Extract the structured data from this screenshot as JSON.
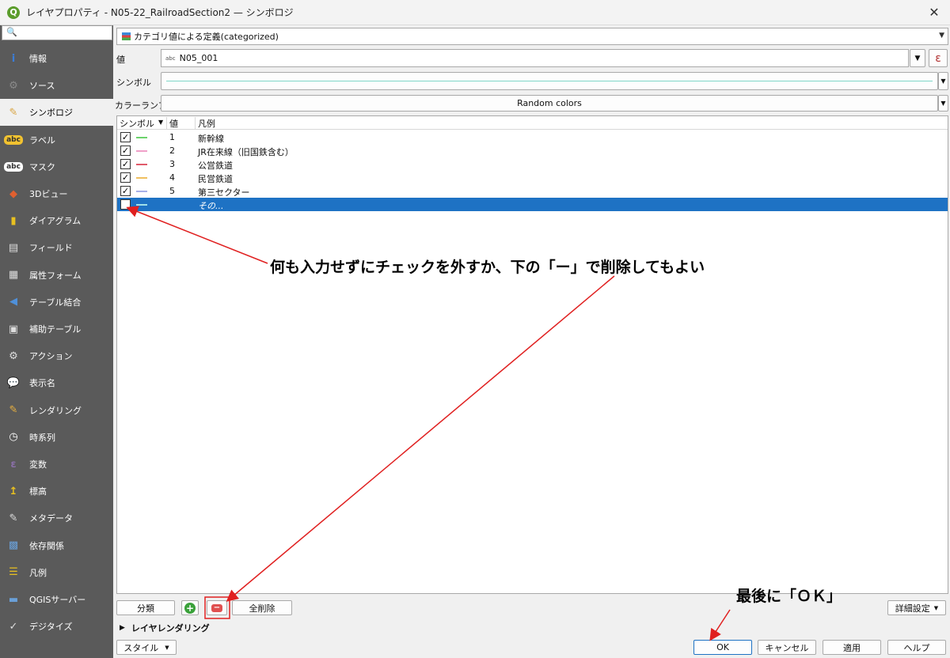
{
  "window": {
    "title": "レイヤプロパティ - N05-22_RailroadSection2 — シンボロジ",
    "app_icon": "Q",
    "close": "✕"
  },
  "sidebar": {
    "search_icon": "🔍",
    "items": [
      {
        "label": "情報",
        "icon": "info-icon",
        "glyph": "i",
        "color": "#3b7dd8"
      },
      {
        "label": "ソース",
        "icon": "source-icon",
        "glyph": "⚙",
        "color": "#8a8a8a"
      },
      {
        "label": "シンボロジ",
        "icon": "paintbrush-icon",
        "glyph": "✎",
        "color": "#d9a441"
      },
      {
        "label": "ラベル",
        "icon": "label-icon",
        "glyph": "abc",
        "color": "#f2c230"
      },
      {
        "label": "マスク",
        "icon": "mask-icon",
        "glyph": "abc",
        "color": "#ffffff"
      },
      {
        "label": "3Dビュー",
        "icon": "cube-icon",
        "glyph": "◆",
        "color": "#e06030"
      },
      {
        "label": "ダイアグラム",
        "icon": "diagram-icon",
        "glyph": "▮",
        "color": "#e8c020"
      },
      {
        "label": "フィールド",
        "icon": "fields-icon",
        "glyph": "▤",
        "color": "#dddddd"
      },
      {
        "label": "属性フォーム",
        "icon": "form-icon",
        "glyph": "▦",
        "color": "#dddddd"
      },
      {
        "label": "テーブル結合",
        "icon": "join-icon",
        "glyph": "◀",
        "color": "#4f90d9"
      },
      {
        "label": "補助テーブル",
        "icon": "auxiliary-icon",
        "glyph": "▣",
        "color": "#dddddd"
      },
      {
        "label": "アクション",
        "icon": "action-icon",
        "glyph": "⚙",
        "color": "#dddddd"
      },
      {
        "label": "表示名",
        "icon": "tooltip-icon",
        "glyph": "💬",
        "color": "#f5c842"
      },
      {
        "label": "レンダリング",
        "icon": "rendering-icon",
        "glyph": "✎",
        "color": "#e8b040"
      },
      {
        "label": "時系列",
        "icon": "clock-icon",
        "glyph": "◷",
        "color": "#ffffff"
      },
      {
        "label": "変数",
        "icon": "variable-icon",
        "glyph": "ε",
        "color": "#8a6fa8"
      },
      {
        "label": "標高",
        "icon": "elevation-icon",
        "glyph": "↥",
        "color": "#e8c020"
      },
      {
        "label": "メタデータ",
        "icon": "metadata-icon",
        "glyph": "✎",
        "color": "#dddddd"
      },
      {
        "label": "依存関係",
        "icon": "dependency-icon",
        "glyph": "▩",
        "color": "#6aa0d8"
      },
      {
        "label": "凡例",
        "icon": "legend-icon",
        "glyph": "☰",
        "color": "#e8c020"
      },
      {
        "label": "QGISサーバー",
        "icon": "server-icon",
        "glyph": "▬",
        "color": "#6aa0d8"
      },
      {
        "label": "デジタイズ",
        "icon": "digitize-icon",
        "glyph": "✓",
        "color": "#dddddd"
      }
    ]
  },
  "renderer": {
    "selected": "カテゴリ値による定義(categorized)"
  },
  "value_field": {
    "label": "値",
    "type_badge": "abc",
    "value": "N05_001",
    "expr_icon": "ε"
  },
  "symbol": {
    "label": "シンボル",
    "line_color": "#7fd6c9"
  },
  "color_ramp": {
    "label": "カラーランプ",
    "value": "Random colors"
  },
  "table": {
    "headers": {
      "symbol": "シンボル",
      "value": "値",
      "legend": "凡例"
    },
    "rows": [
      {
        "checked": true,
        "color": "#6cd36c",
        "value": "1",
        "legend": "新幹線"
      },
      {
        "checked": true,
        "color": "#f0a0c8",
        "value": "2",
        "legend": "JR在来線（旧国鉄含む）"
      },
      {
        "checked": true,
        "color": "#e05a6a",
        "value": "3",
        "legend": "公営鉄道"
      },
      {
        "checked": true,
        "color": "#f0c060",
        "value": "4",
        "legend": "民営鉄道"
      },
      {
        "checked": true,
        "color": "#a8b0e8",
        "value": "5",
        "legend": "第三セクター"
      },
      {
        "checked": false,
        "color": "#9fe0e8",
        "value": "",
        "legend": "その..."
      }
    ]
  },
  "buttons": {
    "classify": "分類",
    "add": "+",
    "remove": "−",
    "delete_all": "全削除",
    "advanced": "詳細設定",
    "layer_rendering": "レイヤレンダリング",
    "style": "スタイル",
    "ok": "OK",
    "cancel": "キャンセル",
    "apply": "適用",
    "help": "ヘルプ"
  },
  "annotations": {
    "uncheck_note": "何も入力せずにチェックを外すか、下の「ー」で削除してもよい",
    "ok_note": "最後に「ＯＫ」"
  },
  "colors": {
    "accent": "#1e72c4",
    "annotation": "#e02020"
  }
}
